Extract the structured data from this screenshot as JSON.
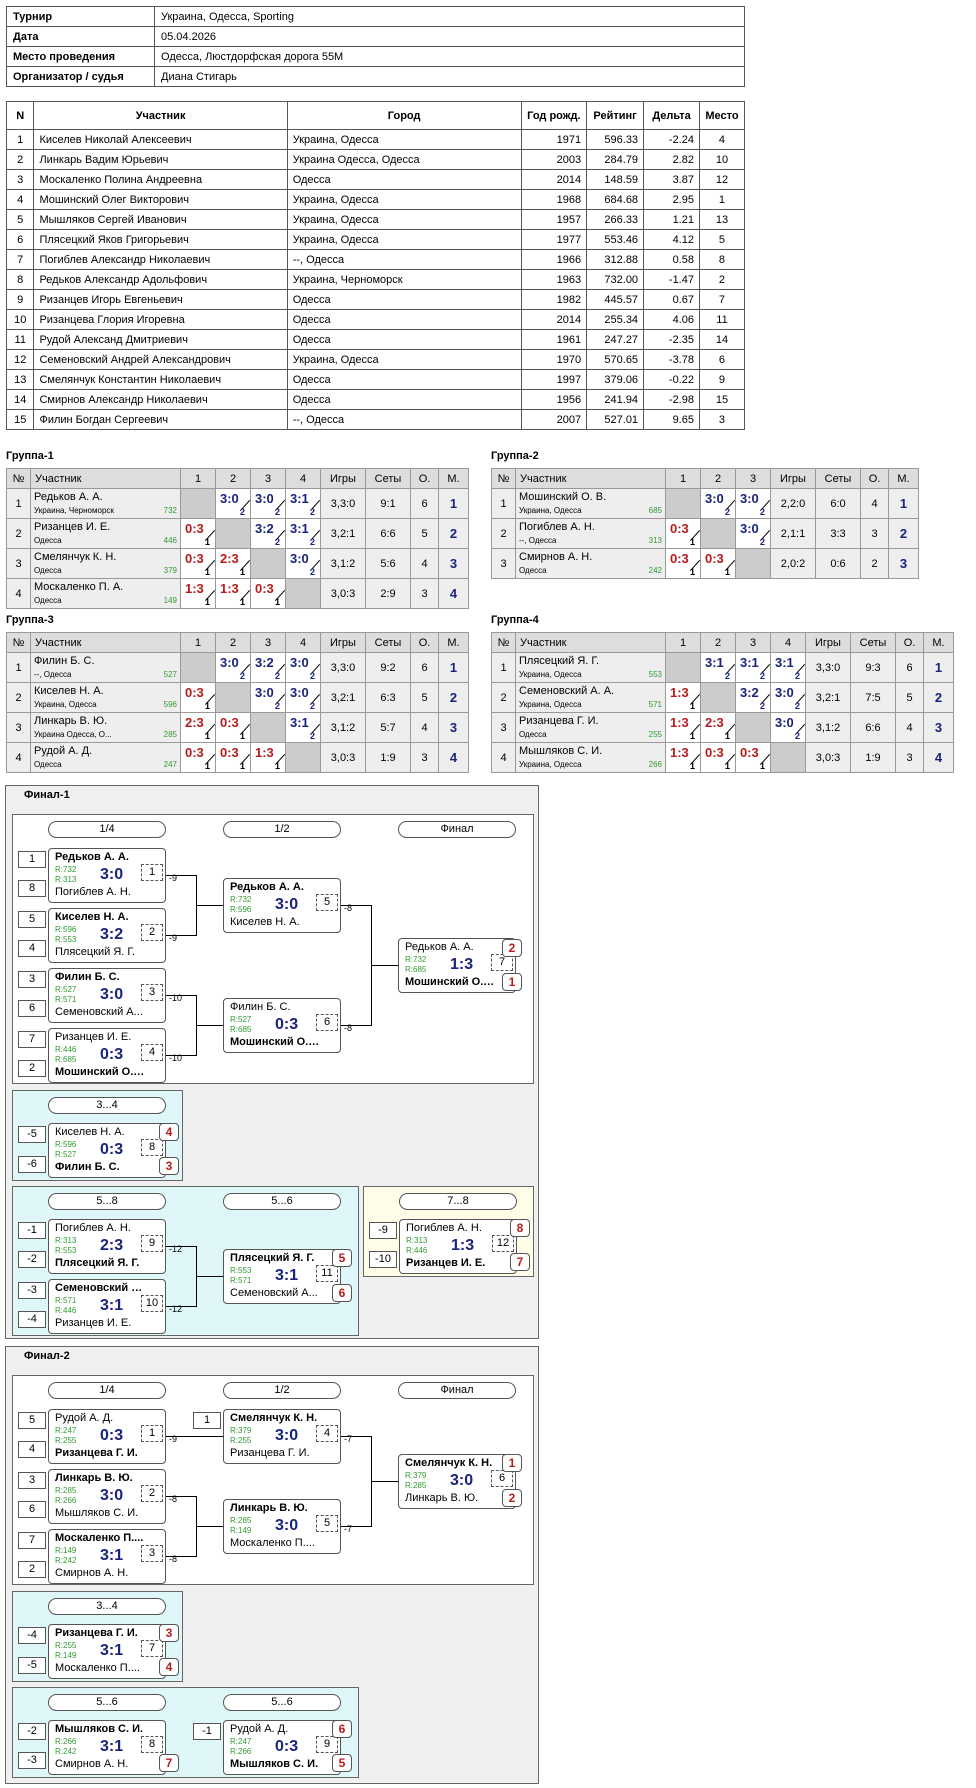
{
  "info": [
    {
      "k": "Турнир",
      "v": "Украина, Одесса, Sporting"
    },
    {
      "k": "Дата",
      "v": "05.04.2026"
    },
    {
      "k": "Место проведения",
      "v": "Одесса, Люстдорфская дорога 55М"
    },
    {
      "k": "Организатор / судья",
      "v": "Диана Стигарь"
    }
  ],
  "players": {
    "headers": [
      "N",
      "Участник",
      "Город",
      "Год рожд.",
      "Рейтинг",
      "Дельта",
      "Место"
    ],
    "rows": [
      [
        "1",
        "Киселев Николай Алексеевич",
        "Украина, Одесса",
        "1971",
        "596.33",
        "-2.24",
        "4"
      ],
      [
        "2",
        "Линкарь Вадим Юрьевич",
        "Украина Одесса, Одесса",
        "2003",
        "284.79",
        "2.82",
        "10"
      ],
      [
        "3",
        "Москаленко Полина Андреевна",
        "Одесса",
        "2014",
        "148.59",
        "3.87",
        "12"
      ],
      [
        "4",
        "Мошинский Олег Викторович",
        "Украина, Одесса",
        "1968",
        "684.68",
        "2.95",
        "1"
      ],
      [
        "5",
        "Мышляков Сергей Иванович",
        "Украина, Одесса",
        "1957",
        "266.33",
        "1.21",
        "13"
      ],
      [
        "6",
        "Плясецкий Яков Григорьевич",
        "Украина, Одесса",
        "1977",
        "553.46",
        "4.12",
        "5"
      ],
      [
        "7",
        "Погиблев Александр Николаевич",
        "--, Одесса",
        "1966",
        "312.88",
        "0.58",
        "8"
      ],
      [
        "8",
        "Редьков Александр Адольфович",
        "Украина, Черноморск",
        "1963",
        "732.00",
        "-1.47",
        "2"
      ],
      [
        "9",
        "Ризанцев Игорь Евгеньевич",
        "Одесса",
        "1982",
        "445.57",
        "0.67",
        "7"
      ],
      [
        "10",
        "Ризанцева Глория Игоревна",
        "Одесса",
        "2014",
        "255.34",
        "4.06",
        "11"
      ],
      [
        "11",
        "Рудой Александ Дмитриевич",
        "Одесса",
        "1961",
        "247.27",
        "-2.35",
        "14"
      ],
      [
        "12",
        "Семеновский Андрей Александрович",
        "Украина, Одесса",
        "1970",
        "570.65",
        "-3.78",
        "6"
      ],
      [
        "13",
        "Смелянчук Константин Николаевич",
        "Одесса",
        "1997",
        "379.06",
        "-0.22",
        "9"
      ],
      [
        "14",
        "Смирнов Александр Николаевич",
        "Одесса",
        "1956",
        "241.94",
        "-2.98",
        "15"
      ],
      [
        "15",
        "Филин Богдан Сергеевич",
        "--, Одесса",
        "2007",
        "527.01",
        "9.65",
        "3"
      ]
    ]
  },
  "group_headers": {
    "n": "№",
    "name": "Участник",
    "games": "Игры",
    "sets": "Сеты",
    "pts": "О.",
    "place": "М."
  },
  "groups": [
    {
      "title": "Группа-1",
      "cols": [
        "1",
        "2",
        "3",
        "4"
      ],
      "rows": [
        {
          "n": "1",
          "name": "Редьков А. А.",
          "city": "Украина, Черноморск",
          "rating": "732",
          "cells": [
            null,
            [
              "3:0",
              "2",
              "w"
            ],
            [
              "3:0",
              "2",
              "w"
            ],
            [
              "3:1",
              "2",
              "w"
            ]
          ],
          "games": "3,3:0",
          "sets": "9:1",
          "pts": "6",
          "place": "1"
        },
        {
          "n": "2",
          "name": "Ризанцев И. Е.",
          "city": "Одесса",
          "rating": "446",
          "cells": [
            [
              "0:3",
              "1",
              "l"
            ],
            null,
            [
              "3:2",
              "2",
              "w"
            ],
            [
              "3:1",
              "2",
              "w"
            ]
          ],
          "games": "3,2:1",
          "sets": "6:6",
          "pts": "5",
          "place": "2"
        },
        {
          "n": "3",
          "name": "Смелянчук К. Н.",
          "city": "Одесса",
          "rating": "379",
          "cells": [
            [
              "0:3",
              "1",
              "l"
            ],
            [
              "2:3",
              "1",
              "l"
            ],
            null,
            [
              "3:0",
              "2",
              "w"
            ]
          ],
          "games": "3,1:2",
          "sets": "5:6",
          "pts": "4",
          "place": "3"
        },
        {
          "n": "4",
          "name": "Москаленко П. А.",
          "city": "Одесса",
          "rating": "149",
          "cells": [
            [
              "1:3",
              "1",
              "l"
            ],
            [
              "1:3",
              "1",
              "l"
            ],
            [
              "0:3",
              "1",
              "l"
            ],
            null
          ],
          "games": "3,0:3",
          "sets": "2:9",
          "pts": "3",
          "place": "4"
        }
      ]
    },
    {
      "title": "Группа-2",
      "cols": [
        "1",
        "2",
        "3"
      ],
      "rows": [
        {
          "n": "1",
          "name": "Мошинский О. В.",
          "city": "Украина, Одесса",
          "rating": "685",
          "cells": [
            null,
            [
              "3:0",
              "2",
              "w"
            ],
            [
              "3:0",
              "2",
              "w"
            ]
          ],
          "games": "2,2:0",
          "sets": "6:0",
          "pts": "4",
          "place": "1"
        },
        {
          "n": "2",
          "name": "Погиблев А. Н.",
          "city": "--, Одесса",
          "rating": "313",
          "cells": [
            [
              "0:3",
              "1",
              "l"
            ],
            null,
            [
              "3:0",
              "2",
              "w"
            ]
          ],
          "games": "2,1:1",
          "sets": "3:3",
          "pts": "3",
          "place": "2"
        },
        {
          "n": "3",
          "name": "Смирнов А. Н.",
          "city": "Одесса",
          "rating": "242",
          "cells": [
            [
              "0:3",
              "1",
              "l"
            ],
            [
              "0:3",
              "1",
              "l"
            ],
            null
          ],
          "games": "2,0:2",
          "sets": "0:6",
          "pts": "2",
          "place": "3"
        }
      ]
    },
    {
      "title": "Группа-3",
      "cols": [
        "1",
        "2",
        "3",
        "4"
      ],
      "rows": [
        {
          "n": "1",
          "name": "Филин Б. С.",
          "city": "--, Одесса",
          "rating": "527",
          "cells": [
            null,
            [
              "3:0",
              "2",
              "w"
            ],
            [
              "3:2",
              "2",
              "w"
            ],
            [
              "3:0",
              "2",
              "w"
            ]
          ],
          "games": "3,3:0",
          "sets": "9:2",
          "pts": "6",
          "place": "1"
        },
        {
          "n": "2",
          "name": "Киселев Н. А.",
          "city": "Украина, Одесса",
          "rating": "596",
          "cells": [
            [
              "0:3",
              "1",
              "l"
            ],
            null,
            [
              "3:0",
              "2",
              "w"
            ],
            [
              "3:0",
              "2",
              "w"
            ]
          ],
          "games": "3,2:1",
          "sets": "6:3",
          "pts": "5",
          "place": "2"
        },
        {
          "n": "3",
          "name": "Линкарь В. Ю.",
          "city": "Украина Одесса, О...",
          "rating": "285",
          "cells": [
            [
              "2:3",
              "1",
              "l"
            ],
            [
              "0:3",
              "1",
              "l"
            ],
            null,
            [
              "3:1",
              "2",
              "w"
            ]
          ],
          "games": "3,1:2",
          "sets": "5:7",
          "pts": "4",
          "place": "3"
        },
        {
          "n": "4",
          "name": "Рудой А. Д.",
          "city": "Одесса",
          "rating": "247",
          "cells": [
            [
              "0:3",
              "1",
              "l"
            ],
            [
              "0:3",
              "1",
              "l"
            ],
            [
              "1:3",
              "1",
              "l"
            ],
            null
          ],
          "games": "3,0:3",
          "sets": "1:9",
          "pts": "3",
          "place": "4"
        }
      ]
    },
    {
      "title": "Группа-4",
      "cols": [
        "1",
        "2",
        "3",
        "4"
      ],
      "rows": [
        {
          "n": "1",
          "name": "Плясецкий Я. Г.",
          "city": "Украина, Одесса",
          "rating": "553",
          "cells": [
            null,
            [
              "3:1",
              "2",
              "w"
            ],
            [
              "3:1",
              "2",
              "w"
            ],
            [
              "3:1",
              "2",
              "w"
            ]
          ],
          "games": "3,3:0",
          "sets": "9:3",
          "pts": "6",
          "place": "1"
        },
        {
          "n": "2",
          "name": "Семеновский А. А.",
          "city": "Украина, Одесса",
          "rating": "571",
          "cells": [
            [
              "1:3",
              "1",
              "l"
            ],
            null,
            [
              "3:2",
              "2",
              "w"
            ],
            [
              "3:0",
              "2",
              "w"
            ]
          ],
          "games": "3,2:1",
          "sets": "7:5",
          "pts": "5",
          "place": "2"
        },
        {
          "n": "3",
          "name": "Ризанцева Г. И.",
          "city": "Одесса",
          "rating": "255",
          "cells": [
            [
              "1:3",
              "1",
              "l"
            ],
            [
              "2:3",
              "1",
              "l"
            ],
            null,
            [
              "3:0",
              "2",
              "w"
            ]
          ],
          "games": "3,1:2",
          "sets": "6:6",
          "pts": "4",
          "place": "3"
        },
        {
          "n": "4",
          "name": "Мышляков С. И.",
          "city": "Украина, Одесса",
          "rating": "266",
          "cells": [
            [
              "1:3",
              "1",
              "l"
            ],
            [
              "0:3",
              "1",
              "l"
            ],
            [
              "0:3",
              "1",
              "l"
            ],
            null
          ],
          "games": "3,0:3",
          "sets": "1:9",
          "pts": "3",
          "place": "4"
        }
      ]
    }
  ],
  "finals": [
    {
      "title": "Финал-1",
      "labels": [
        {
          "t": "1/4"
        },
        {
          "t": "1/2"
        },
        {
          "t": "Финал"
        },
        {
          "t": "3...4"
        },
        {
          "t": "5...8"
        },
        {
          "t": "5...6"
        },
        {
          "t": "7...8"
        }
      ],
      "seeds": [
        "1",
        "8",
        "5",
        "4",
        "3",
        "6",
        "7",
        "2",
        "-5",
        "-6",
        "-1",
        "-2",
        "-3",
        "-4",
        "-9",
        "-10"
      ],
      "links": [
        "-9",
        "-9",
        "-10",
        "-10",
        "-8",
        "-8",
        "-12",
        "-12"
      ],
      "matches": [
        {
          "a": "Редьков А. А.",
          "ra": "R:732",
          "b": "Погиблев А. Н.",
          "rb": "R:313",
          "s": "3:0",
          "id": "1",
          "w": "a"
        },
        {
          "a": "Киселев Н. А.",
          "ra": "R:596",
          "b": "Плясецкий Я. Г.",
          "rb": "R:553",
          "s": "3:2",
          "id": "2",
          "w": "a"
        },
        {
          "a": "Филин Б. С.",
          "ra": "R:527",
          "b": "Семеновский А...",
          "rb": "R:571",
          "s": "3:0",
          "id": "3",
          "w": "a"
        },
        {
          "a": "Ризанцев И. Е.",
          "ra": "R:446",
          "b": "Мошинский О. В.",
          "rb": "R:685",
          "s": "0:3",
          "id": "4",
          "w": "b"
        },
        {
          "a": "Редьков А. А.",
          "ra": "R:732",
          "b": "Киселев Н. А.",
          "rb": "R:596",
          "s": "3:0",
          "id": "5",
          "w": "a"
        },
        {
          "a": "Филин Б. С.",
          "ra": "R:527",
          "b": "Мошинский О. В.",
          "rb": "R:685",
          "s": "0:3",
          "id": "6",
          "w": "b"
        },
        {
          "a": "Редьков А. А.",
          "ra": "R:732",
          "b": "Мошинский О. В.",
          "rb": "R:685",
          "s": "1:3",
          "id": "7",
          "w": "b"
        },
        {
          "a": "Киселев Н. А.",
          "ra": "R:596",
          "b": "Филин Б. С.",
          "rb": "R:527",
          "s": "0:3",
          "id": "8",
          "w": "b"
        },
        {
          "a": "Погиблев А. Н.",
          "ra": "R:313",
          "b": "Плясецкий Я. Г.",
          "rb": "R:553",
          "s": "2:3",
          "id": "9",
          "w": "b"
        },
        {
          "a": "Семеновский А...",
          "ra": "R:571",
          "b": "Ризанцев И. Е.",
          "rb": "R:446",
          "s": "3:1",
          "id": "10",
          "w": "a"
        },
        {
          "a": "Плясецкий Я. Г.",
          "ra": "R:553",
          "b": "Семеновский А...",
          "rb": "R:571",
          "s": "3:1",
          "id": "11",
          "w": "a"
        },
        {
          "a": "Погиблев А. Н.",
          "ra": "R:313",
          "b": "Ризанцев И. Е.",
          "rb": "R:446",
          "s": "1:3",
          "id": "12",
          "w": "b"
        }
      ],
      "places": [
        "2",
        "1",
        "4",
        "3",
        "5",
        "6",
        "8",
        "7"
      ]
    },
    {
      "title": "Финал-2",
      "labels": [
        {
          "t": "1/4"
        },
        {
          "t": "1/2"
        },
        {
          "t": "Финал"
        },
        {
          "t": "3...4"
        },
        {
          "t": "5...6"
        },
        {
          "t": "5...6"
        }
      ],
      "seeds": [
        "5",
        "4",
        "3",
        "6",
        "7",
        "2",
        "1",
        "-4",
        "-5",
        "-2",
        "-3",
        "-1"
      ],
      "links": [
        "-9",
        "-8",
        "-8",
        "-7",
        "-7"
      ],
      "matches": [
        {
          "a": "Рудой А. Д.",
          "ra": "R:247",
          "b": "Ризанцева Г. И.",
          "rb": "R:255",
          "s": "0:3",
          "id": "1",
          "w": "b"
        },
        {
          "a": "Линкарь В. Ю.",
          "ra": "R:285",
          "b": "Мышляков С. И.",
          "rb": "R:266",
          "s": "3:0",
          "id": "2",
          "w": "a"
        },
        {
          "a": "Москаленко П....",
          "ra": "R:149",
          "b": "Смирнов А. Н.",
          "rb": "R:242",
          "s": "3:1",
          "id": "3",
          "w": "a"
        },
        {
          "a": "Смелянчук К. Н.",
          "ra": "R:379",
          "b": "Ризанцева Г. И.",
          "rb": "R:255",
          "s": "3:0",
          "id": "4",
          "w": "a"
        },
        {
          "a": "Линкарь В. Ю.",
          "ra": "R:285",
          "b": "Москаленко П....",
          "rb": "R:149",
          "s": "3:0",
          "id": "5",
          "w": "a"
        },
        {
          "a": "Смелянчук К. Н.",
          "ra": "R:379",
          "b": "Линкарь В. Ю.",
          "rb": "R:285",
          "s": "3:0",
          "id": "6",
          "w": "a"
        },
        {
          "a": "Ризанцева Г. И.",
          "ra": "R:255",
          "b": "Москаленко П....",
          "rb": "R:149",
          "s": "3:1",
          "id": "7",
          "w": "a"
        },
        {
          "a": "Мышляков С. И.",
          "ra": "R:266",
          "b": "Смирнов А. Н.",
          "rb": "R:242",
          "s": "3:1",
          "id": "8",
          "w": "a"
        },
        {
          "a": "Рудой А. Д.",
          "ra": "R:247",
          "b": "Мышляков С. И.",
          "rb": "R:266",
          "s": "0:3",
          "id": "9",
          "w": "b"
        }
      ],
      "places": [
        "1",
        "2",
        "3",
        "4",
        "7",
        "6",
        "5"
      ]
    }
  ]
}
